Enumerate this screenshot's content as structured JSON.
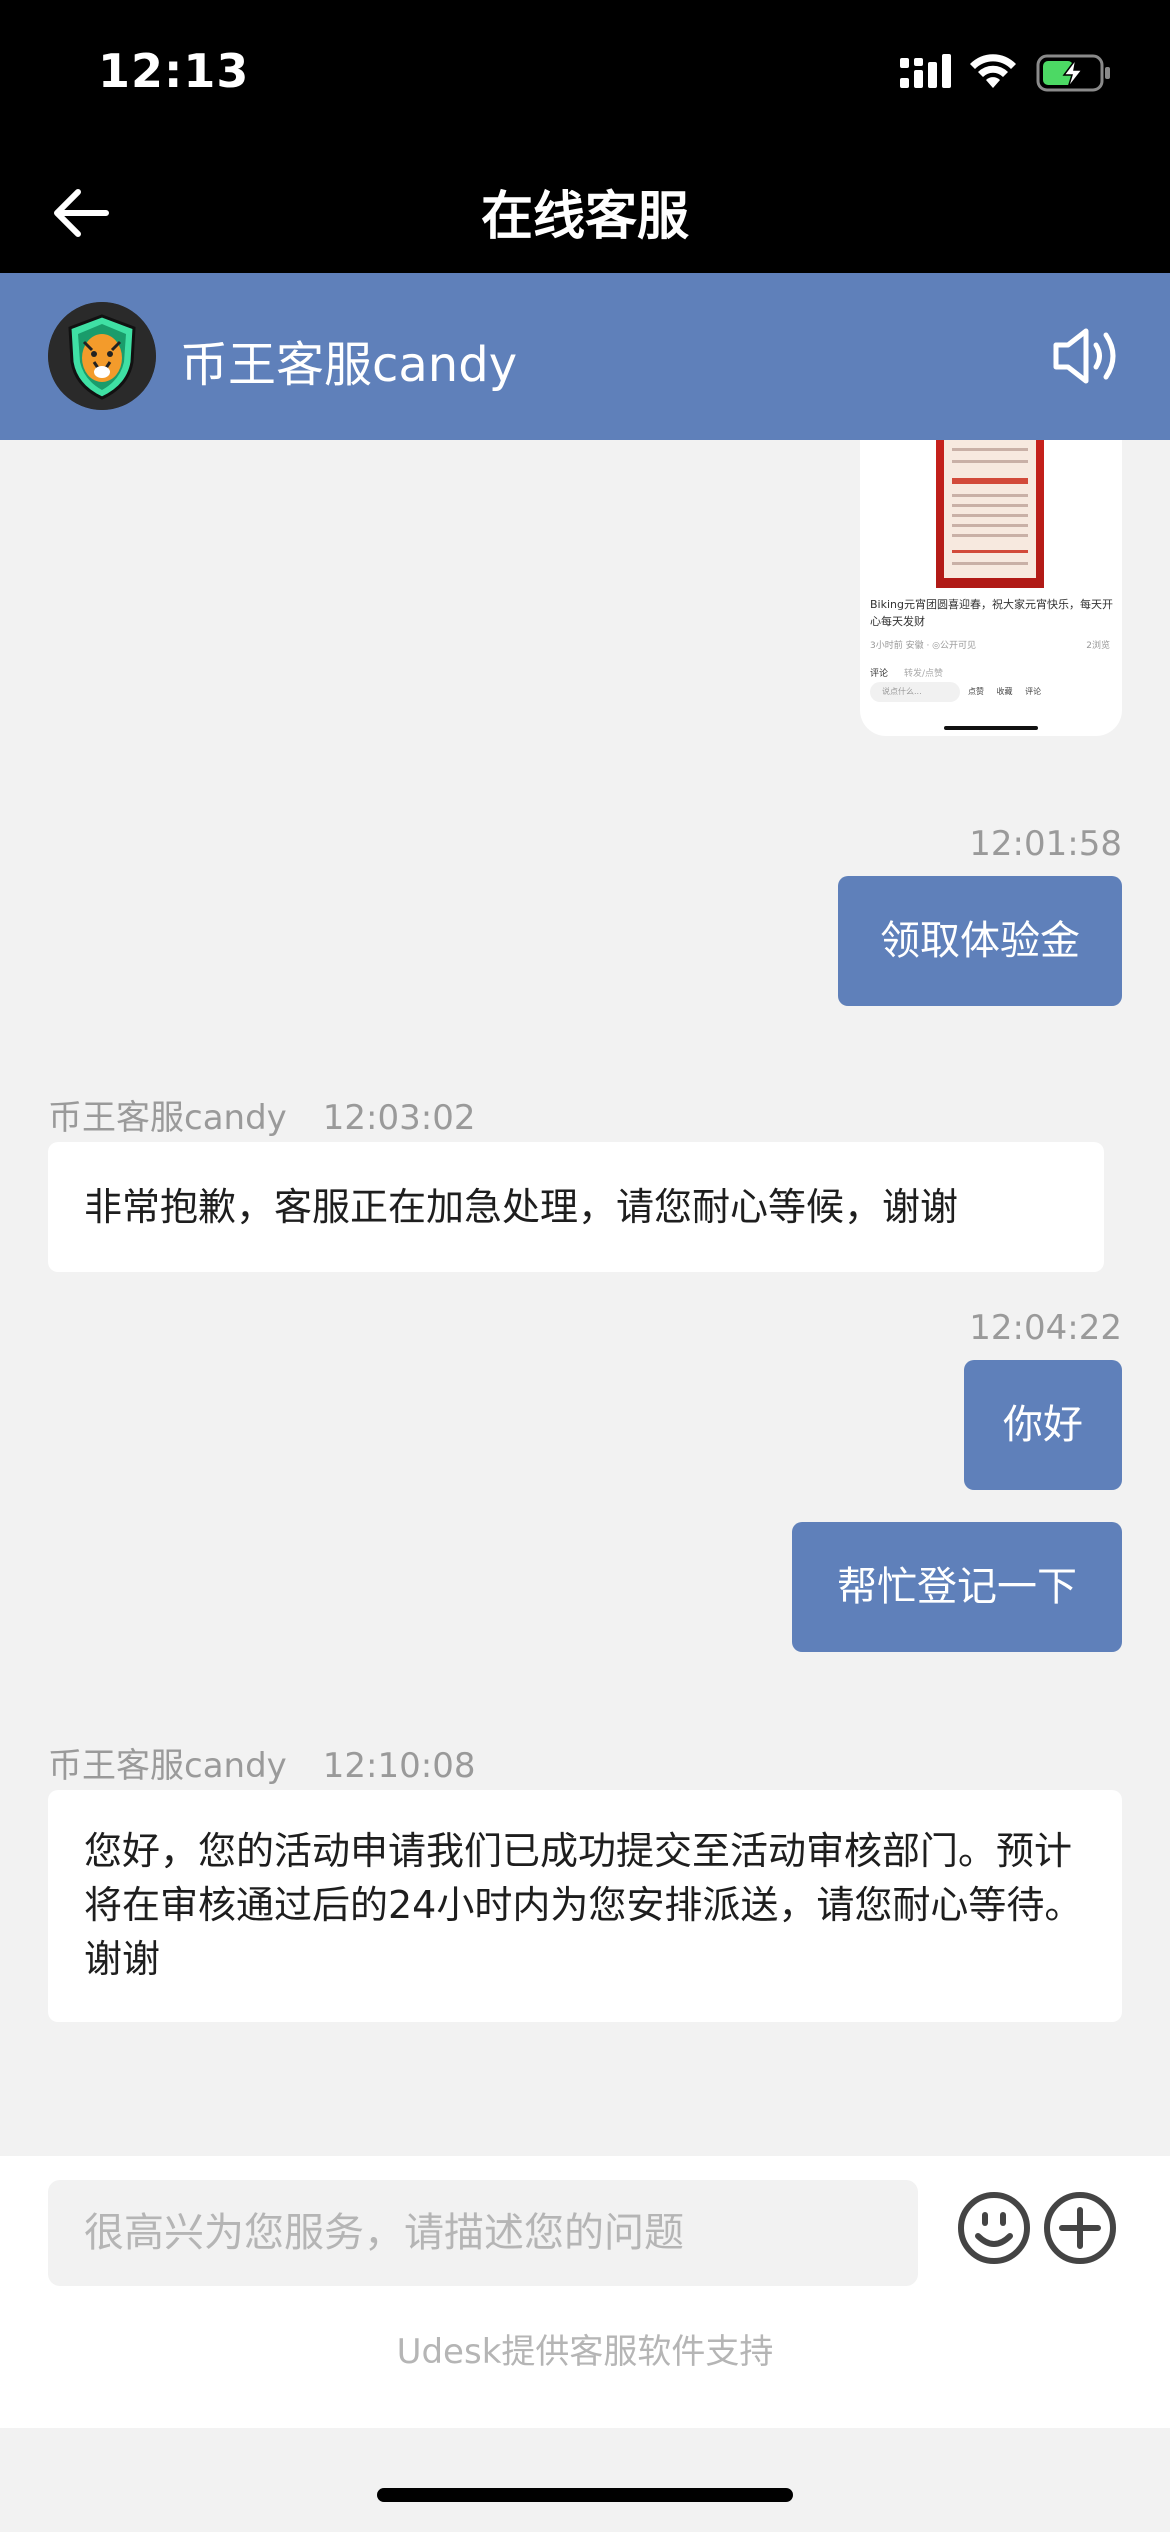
{
  "status_bar": {
    "time": "12:13"
  },
  "nav": {
    "title": "在线客服"
  },
  "agent": {
    "name": "币王客服candy"
  },
  "card": {
    "caption": "Biking元宵团圆喜迎春，祝大家元宵快乐，每天开心每天发财",
    "meta": "3小时前 安徽 · ◎公开可见",
    "meta_right": "2浏览",
    "tab_comments": "评论",
    "tab_other": "转发/点赞",
    "input_placeholder": "说点什么...",
    "actions": [
      "点赞",
      "收藏",
      "评论"
    ]
  },
  "messages": [
    {
      "dir": "out",
      "time": "12:01:58",
      "text": "领取体验金"
    },
    {
      "dir": "in",
      "sender": "币王客服candy",
      "time": "12:03:02",
      "text": "非常抱歉，客服正在加急处理，请您耐心等候，谢谢"
    },
    {
      "dir": "out",
      "time": "12:04:22",
      "text": "你好"
    },
    {
      "dir": "out",
      "text": "帮忙登记一下"
    },
    {
      "dir": "in",
      "sender": "币王客服candy",
      "time": "12:10:08",
      "text": "您好，您的活动申请我们已成功提交至活动审核部门。预计将在审核通过后的24小时内为您安排派送，请您耐心等待。谢谢"
    }
  ],
  "input": {
    "placeholder": "很高兴为您服务，请描述您的问题"
  },
  "footer": {
    "powered_by": "Udesk提供客服软件支持"
  },
  "icons": {
    "back": "arrow-left-icon",
    "sound": "speaker-icon",
    "emoji": "smiley-icon",
    "plus": "plus-circle-icon",
    "signal": "signal-icon",
    "wifi": "wifi-icon",
    "battery": "battery-charging-icon"
  },
  "colors": {
    "accent": "#5f80ba",
    "battery": "#4cd964"
  }
}
